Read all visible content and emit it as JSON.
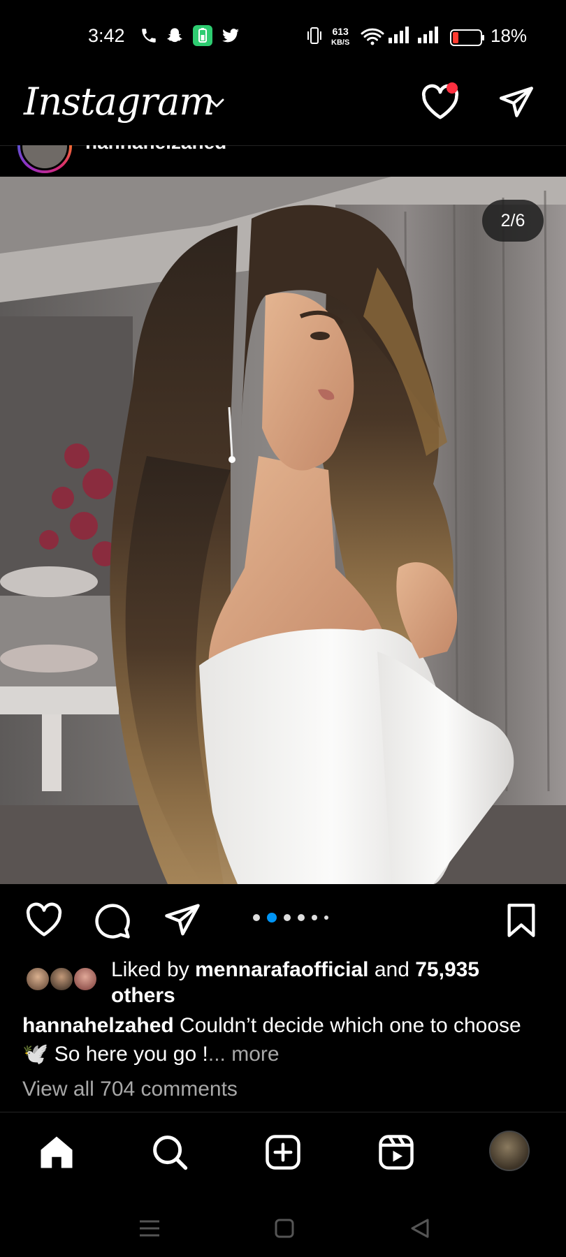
{
  "status_bar": {
    "time": "3:42",
    "net_speed_value": "613",
    "net_speed_unit": "KB/S",
    "battery_percent": "18%"
  },
  "header": {
    "logo": "Instagram"
  },
  "post": {
    "username": "hannahelzahed",
    "image_counter": "2/6",
    "carousel_total": 6,
    "carousel_active_index": 1,
    "liked_by_prefix": "Liked by ",
    "liked_by_user": "mennarafaofficial",
    "liked_by_and": " and ",
    "liked_by_count": "75,935",
    "liked_by_others": "others",
    "caption_user": "hannahelzahed",
    "caption_text": " Couldn’t decide which one to choose",
    "caption_line2_emoji": "🕊️",
    "caption_line2_text": " So here you go !",
    "caption_more": "... more",
    "view_comments": "View all 704 comments"
  },
  "colors": {
    "background": "#000000",
    "accent_blue": "#0095f6",
    "notification_red": "#ff3040",
    "secondary_text": "#a8a8a8"
  },
  "icons": {
    "status": [
      "phone-icon",
      "snapchat-icon",
      "battery-saver-icon",
      "twitter-icon",
      "vibrate-icon",
      "wifi-icon",
      "signal-icon",
      "battery-icon"
    ],
    "header": [
      "chevron-down-icon",
      "heart-icon",
      "send-icon"
    ],
    "actions": [
      "like-icon",
      "comment-icon",
      "share-icon",
      "bookmark-icon"
    ],
    "bottom_nav": [
      "home-icon",
      "search-icon",
      "create-icon",
      "reels-icon",
      "profile-avatar"
    ],
    "system_nav": [
      "menu-icon",
      "home-square-icon",
      "back-triangle-icon"
    ]
  }
}
